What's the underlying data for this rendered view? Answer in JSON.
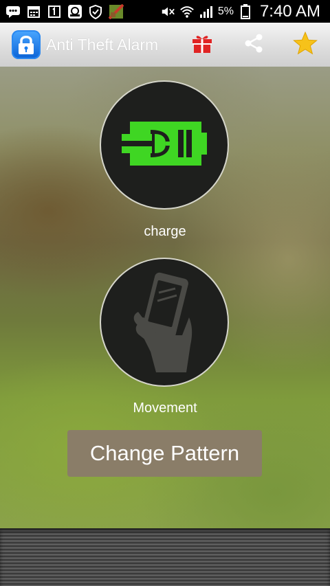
{
  "status_bar": {
    "battery": "5%",
    "time": "7:40 AM",
    "icons": [
      "messages-icon",
      "calendar-icon",
      "notification-1-icon",
      "chat-icon",
      "vpn-icon",
      "game-icon",
      "mute-icon",
      "wifi-icon",
      "signal-icon",
      "battery-icon"
    ]
  },
  "app_bar": {
    "title": "Anti Theft Alarm",
    "logo_icon": "padlock-icon",
    "actions": [
      "gift-icon",
      "share-icon",
      "star-icon"
    ],
    "colors": {
      "gift": "#e02424",
      "star": "#f6c21a",
      "share": "#ffffff",
      "logo": "#1a7ef0"
    }
  },
  "main": {
    "charge_label": "charge",
    "movement_label": "Movement",
    "change_pattern_label": "Change Pattern",
    "colors": {
      "charge_icon": "#3fd623",
      "movement_icon": "#4a4a46",
      "button": "#8a7d68"
    }
  }
}
